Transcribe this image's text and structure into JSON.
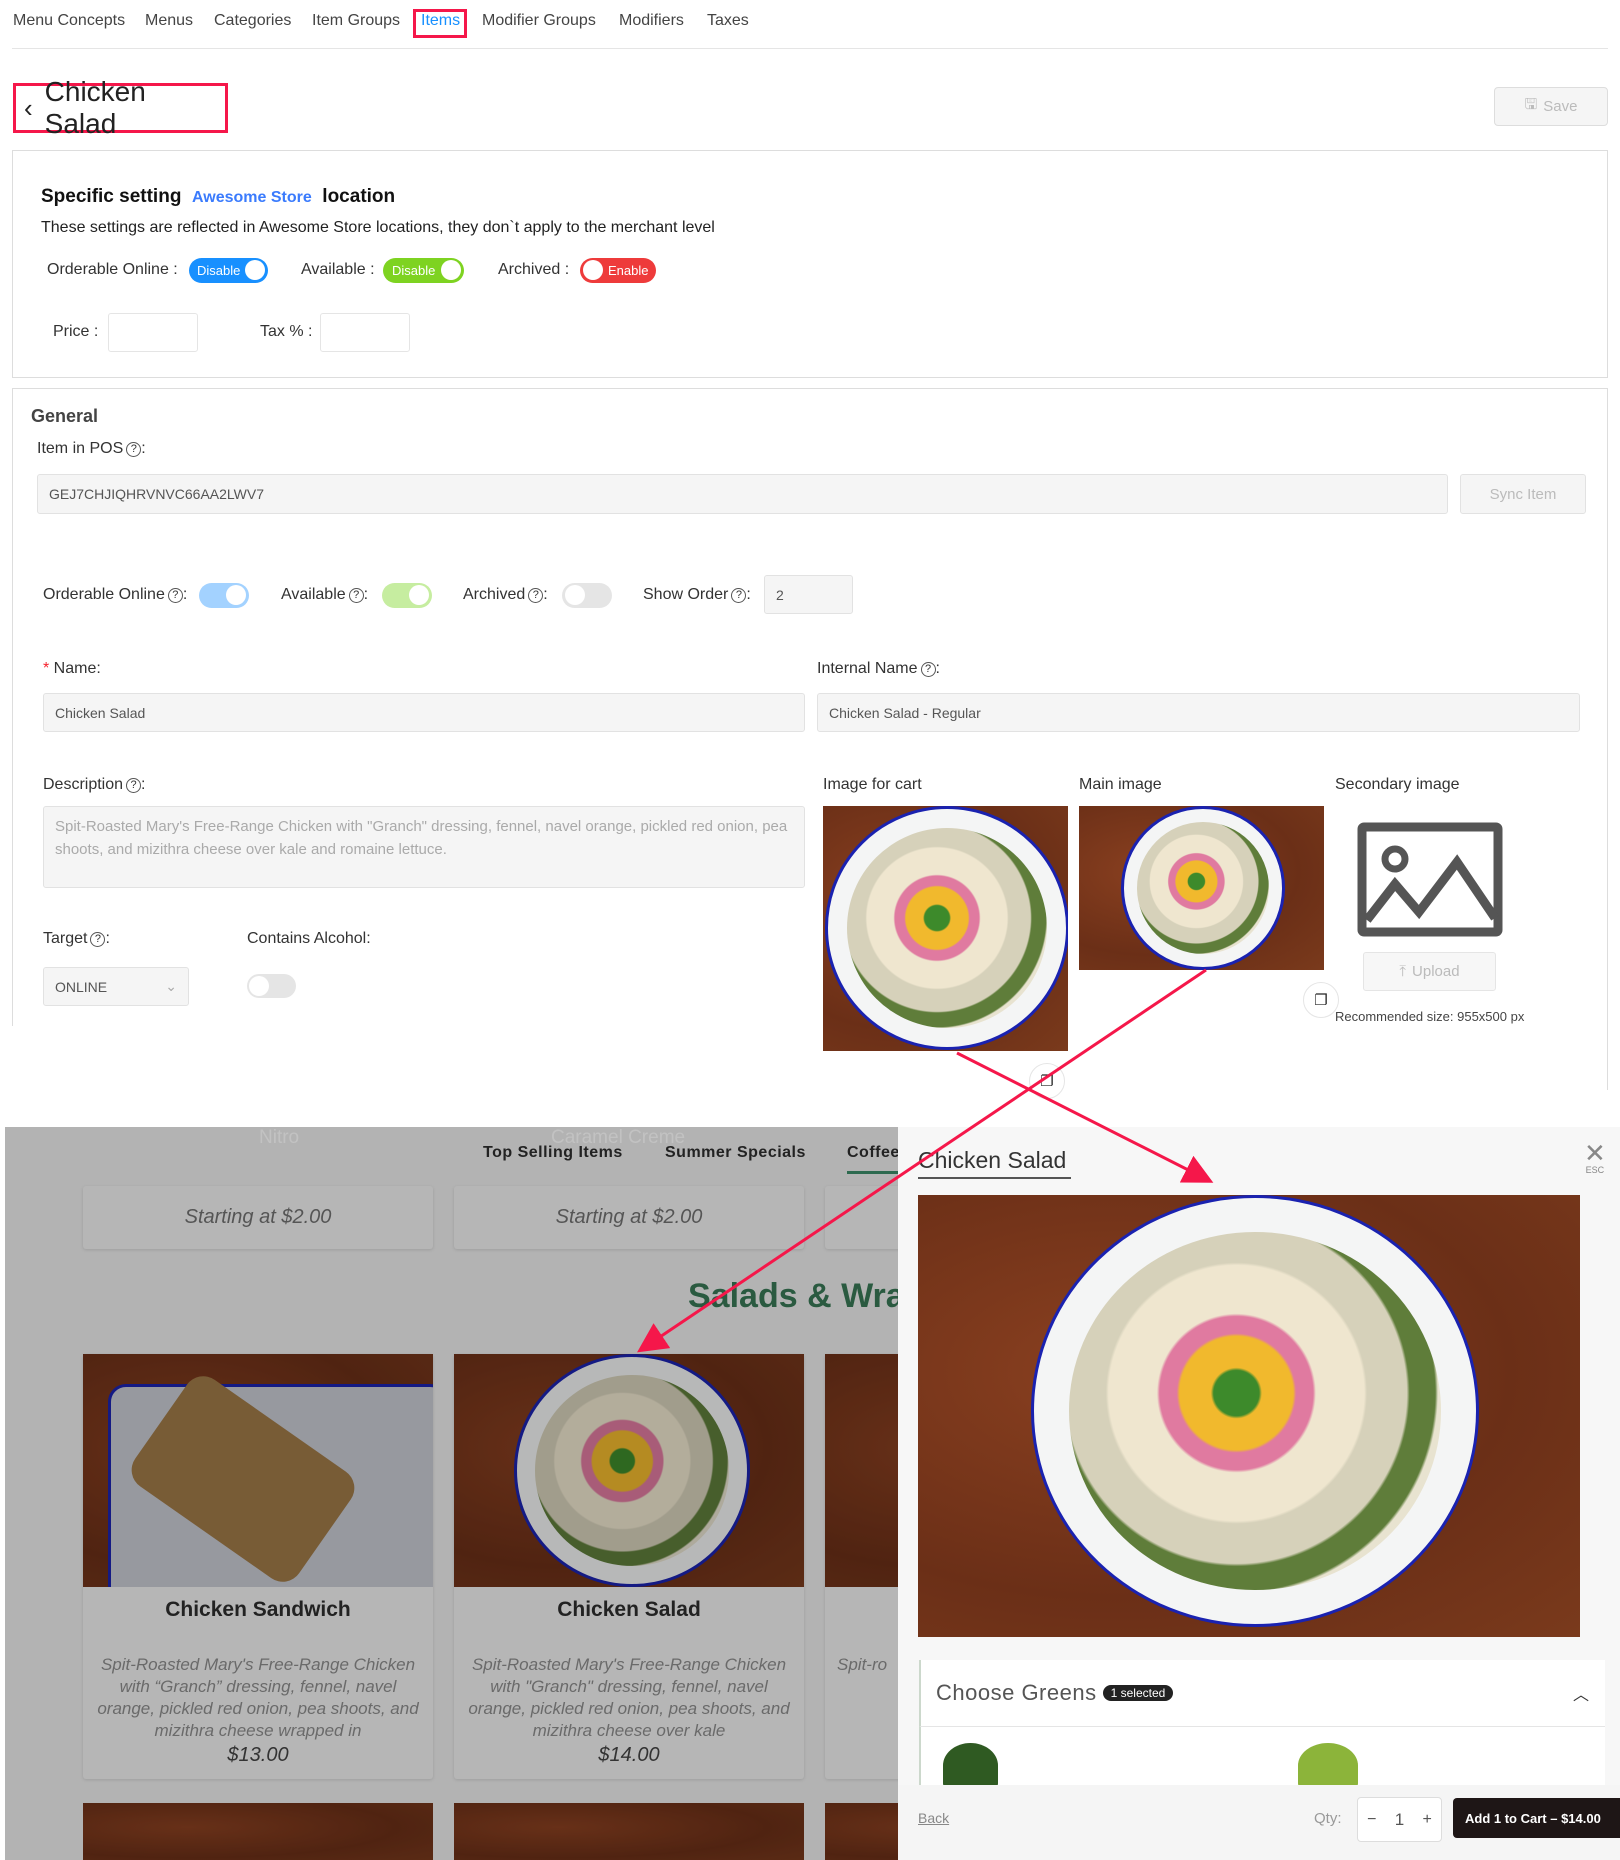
{
  "nav": {
    "items": [
      "Menu Concepts",
      "Menus",
      "Categories",
      "Item Groups",
      "Items",
      "Modifier Groups",
      "Modifiers",
      "Taxes"
    ],
    "active": "Items"
  },
  "header": {
    "title": "Chicken Salad",
    "save_label": "Save"
  },
  "specific": {
    "title": "Specific setting",
    "store": "Awesome Store",
    "suffix": "location",
    "note": "These settings are reflected in Awesome Store locations, they don`t apply to the merchant level",
    "orderable_label": "Orderable Online",
    "orderable_toggle": "Disable",
    "available_label": "Available",
    "available_toggle": "Disable",
    "archived_label": "Archived",
    "archived_toggle": "Enable",
    "price_label": "Price",
    "tax_label": "Tax %",
    "price_value": "",
    "tax_value": ""
  },
  "general": {
    "title": "General",
    "pos_label": "Item in POS",
    "pos_value": "GEJ7CHJIQHRVNVC66AA2LWV7",
    "sync_label": "Sync Item",
    "orderable_label": "Orderable Online",
    "orderable_on": true,
    "available_label": "Available",
    "available_on": true,
    "archived_label": "Archived",
    "archived_on": false,
    "show_order_label": "Show Order",
    "show_order_value": "2",
    "name_label": "Name",
    "name_value": "Chicken Salad",
    "internal_label": "Internal Name",
    "internal_value": "Chicken Salad - Regular",
    "description_label": "Description",
    "description_value": "Spit-Roasted Mary's Free-Range Chicken with \"Granch\" dressing, fennel, navel orange, pickled red onion, pea shoots, and mizithra cheese over kale and romaine lettuce.",
    "target_label": "Target",
    "target_value": "ONLINE",
    "alcohol_label": "Contains Alcohol",
    "alcohol_on": false,
    "cart_image_label": "Image for cart",
    "main_image_label": "Main image",
    "secondary_image_label": "Secondary image",
    "upload_label": "Upload",
    "recommended": "Recommended size: 955x500 px"
  },
  "store": {
    "ghost": [
      "Nitro",
      "Caramel Creme"
    ],
    "tabs": [
      "Top Selling Items",
      "Summer Specials",
      "Coffee"
    ],
    "starting": [
      "Starting at $2.00",
      "Starting at $2.00"
    ],
    "section": "Salads & Wraps",
    "products": [
      {
        "name": "Chicken Sandwich",
        "desc": "Spit-Roasted Mary's Free-Range Chicken with “Granch” dressing, fennel, navel orange, pickled red onion, pea shoots, and mizithra cheese wrapped in",
        "price": "$13.00"
      },
      {
        "name": "Chicken Salad",
        "desc": "Spit-Roasted Mary's Free-Range Chicken with \"Granch\" dressing, fennel, navel orange, pickled red onion, pea shoots, and mizithra cheese over kale",
        "price": "$14.00"
      },
      {
        "desc": "Spit-ro"
      }
    ]
  },
  "modal": {
    "title": "Chicken Salad",
    "esc": "ESC",
    "group": "Choose Greens",
    "badge": "1 selected",
    "back": "Back",
    "qty_label": "Qty:",
    "qty": "1",
    "minus": "−",
    "plus": "+",
    "add": "Add 1 to Cart – $14.00"
  },
  "colors": {
    "accent": "#1890ff",
    "green": "#7ed321",
    "red": "#ee3b3b",
    "highlight": "#f5174a"
  }
}
